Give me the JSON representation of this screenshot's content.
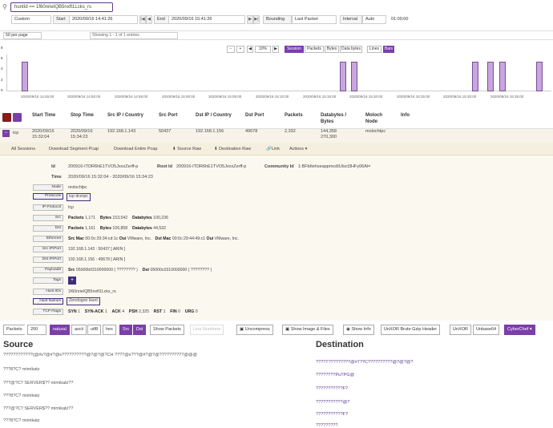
{
  "search": {
    "value": "huntId == 1f60nrieIQB5nxft1Lcks_rs"
  },
  "toolbar": {
    "time_mode": "Custom",
    "start_label": "Start",
    "start_value": "2020/09/16 14:41:26",
    "end_label": "End",
    "end_value": "2020/09/16 15:41:26",
    "bounding_label": "Bounding",
    "bounding_value": "Last Packet",
    "interval_label": "Interval",
    "interval_value": "Auto",
    "duration": "01:00:00",
    "nav_first": "|◀",
    "nav_prev": "◀",
    "nav_next": "▶",
    "nav_last": "▶|"
  },
  "paging": {
    "per_page": "50 per page",
    "showing": "Showing 1 - 1 of 1 entries"
  },
  "timeline": {
    "zoom_out": "−",
    "zoom_in": "+",
    "zoom": "10%",
    "zoom_left": "◀",
    "zoom_right": "▶",
    "buttons": [
      "Session",
      "Packets",
      "Bytes",
      "Data bytes"
    ],
    "active": "Session",
    "style_buttons": [
      "Lines",
      "Bars"
    ],
    "style_active": "Bars",
    "yticks": [
      "8",
      "6",
      "4",
      "2",
      "0"
    ],
    "xticks": [
      "2020/09/16 14:45:00",
      "2020/09/16 14:50:00",
      "2020/09/16 14:55:00",
      "2020/09/16 15:00:00",
      "2020/09/16 15:05:00",
      "2020/09/16 15:10:00",
      "2020/09/16 15:15:00",
      "2020/09/16 15:20:00",
      "2020/09/16 15:25:00",
      "2020/09/16 15:30:00",
      "2020/09/16 15:35:00"
    ]
  },
  "table": {
    "columns": [
      "Start Time",
      "Stop Time",
      "Src IP / Country",
      "Src Port",
      "Dst IP / Country",
      "Dst Port",
      "Packets",
      "Databytes / Bytes",
      "Moloch Node",
      "Info"
    ],
    "row": {
      "protocol": "tcp",
      "start": "2020/09/16 15:32:04",
      "stop": "2020/09/16 15:34:23",
      "src_ip": "192.168.1.143",
      "src_port": "50437",
      "dst_ip": "192.168.1.156",
      "dst_port": "49678",
      "packets": "2,332",
      "bytes": "144,358",
      "databytes": "270,300",
      "node": "molochtpc"
    }
  },
  "actions": {
    "all_sessions": "All Sessions",
    "download_segment": "Download Segment Pcap",
    "download_entire": "Download Entire Pcap",
    "source_raw": "Source Raw",
    "dest_raw": "Destination Raw",
    "link": "Link",
    "actions": "Actions"
  },
  "detail": {
    "id_label": "Id",
    "id_value": "200916-ITDR6hE1TVO5JxxxZerff-p",
    "root_label": "Root Id",
    "root_value": "200916-ITDR6hE1TVO5JxxxZerff-p",
    "community_label": "Community Id",
    "community_value": "1:BFbItehseappmcdIUlsct3HFy06Al=",
    "time_label": "Time",
    "time_value": "2020/09/16 15:32:04 - 2020/09/16 15:34:23",
    "node_label": "Node",
    "node_value": "molochtpc",
    "protocols_label": "Protocols",
    "protocols_value": "tcp  dcerpc",
    "ipproto_label": "IP Protocol",
    "ipproto_value": "tcp",
    "src_label": "Src",
    "src_packets": "1,171",
    "src_bytes": "153,542",
    "src_databytes": "100,236",
    "dst_label": "Dst",
    "dst_packets": "1,161",
    "dst_bytes": "106,858",
    "dst_databytes": "44,532",
    "ether_label": "Ethernet",
    "src_mac": "00:0c:29:34:cd:1c",
    "src_oui": "VMware, Inc.",
    "dst_mac": "00:0c:29:44:49:c1",
    "dst_oui": "VMware, Inc.",
    "srcipport_label": "Src IP/Port",
    "srcipport_value": "192.168.1.143 : 50437 [ ARIN ]",
    "dstipport_label": "Dst IP/Port",
    "dstipport_value": "192.168.1.156 : 49678 [ ARIN ]",
    "payload_label": "Payload8",
    "payload_src": "05000b0310000000 ( ???????? )",
    "payload_dst": "05000c0310000000 ( ???????? )",
    "tags_label": "Tags",
    "huntids_label": "Hunt IDs",
    "huntids_value": "1f60nrieIQB5nxft1Lcks_rs",
    "huntnames_label": "Hunt Names",
    "huntnames_value": "Zerologon Hunt",
    "tcpflags_label": "TCP Flags",
    "syn": "1",
    "synack": "1",
    "ack": "4",
    "psh": "2,325",
    "rst": "1",
    "fin": "0",
    "urg": "0"
  },
  "viewer": {
    "packets_label": "Packets",
    "packets_value": "200",
    "buttons": [
      "natural",
      "ascii",
      "utf8",
      "hex"
    ],
    "active": "natural",
    "dir_buttons": [
      "Src",
      "Dst"
    ],
    "show_packets": "Show Packets",
    "line_numbers": "Line Numbers",
    "uncompress": "Uncompress",
    "show_images": "Show Image & Files",
    "show_info": "Show Info",
    "b64gzip": "UnXOR Brute Gzip Header",
    "unxor": "UnXOR",
    "unbase64": "Unbase64",
    "cyberchef": "CyberChef"
  },
  "source": {
    "title": "Source",
    "lines": [
      "????????????(@#x?@#?@s??????????@?@?@?CH ????@x???@#?@?@??????????@@@",
      "???8?C? mimikatz",
      "???@?C? SERVER$?? mimikatz??",
      "???8?C? mimikatz",
      "???@?C? SERVER$?? mimikatz??",
      "???8?C? mimikatz"
    ]
  },
  "destination": {
    "title": "Destination",
    "lines": [
      "????T?????????@#7??C??????????@?@?@?",
      "????????PuTPG@",
      "???????????F?",
      "???????????@?",
      "???????????F?",
      "?????????"
    ]
  },
  "colors": {
    "accent": "#7b3fa8",
    "bar_fill": "#c9a6dd",
    "highlight": "#3b2f7a"
  }
}
